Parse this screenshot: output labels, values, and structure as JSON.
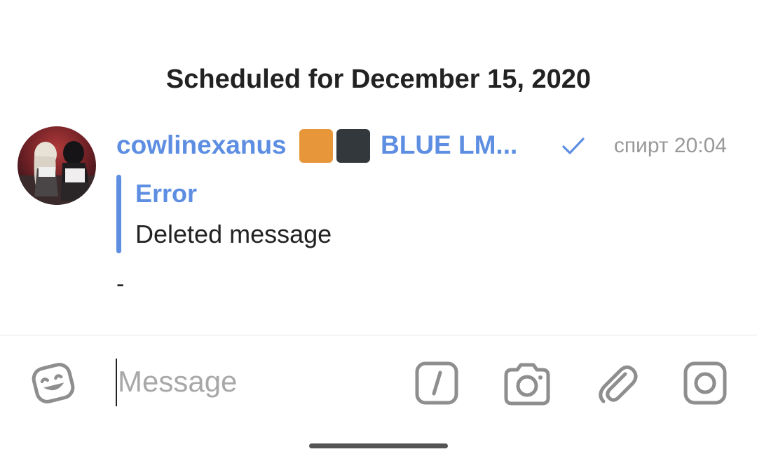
{
  "date_header": "Scheduled for December 15, 2020",
  "message": {
    "sender": "cowlinexanus",
    "forwarded_name": "BLUE LM...",
    "badge_colors": [
      "#e8963a",
      "#33383d"
    ],
    "status": "sent-check",
    "time": "спирт 20:04",
    "reply": {
      "title": "Error",
      "text": "Deleted message"
    },
    "text": "-"
  },
  "input": {
    "placeholder": "Message",
    "value": ""
  },
  "icons": {
    "emoji": "sticker-emoji-icon",
    "commands": "bot-commands-icon",
    "camera": "camera-icon",
    "attach": "paperclip-icon",
    "instagram": "instagram-icon"
  },
  "colors": {
    "accent": "#5d8ee2",
    "text": "#222222",
    "muted": "#999999",
    "icon": "#8e8e8e"
  }
}
